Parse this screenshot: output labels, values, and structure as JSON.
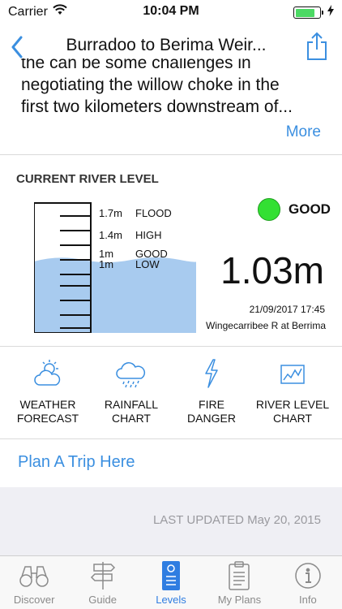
{
  "status_bar": {
    "carrier": "Carrier",
    "time": "10:04 PM",
    "battery_level": 0.8
  },
  "nav": {
    "title": "Burradoo to Berima Weir..."
  },
  "description": {
    "lines": [
      "the can be some challenges in",
      "negotiating the willow choke in the",
      "first two kilometers downstream of..."
    ],
    "more_label": "More"
  },
  "river_level": {
    "heading": "CURRENT RIVER LEVEL",
    "markers": [
      {
        "value": "1.7m",
        "label": "FLOOD"
      },
      {
        "value": "1.4m",
        "label": "HIGH"
      },
      {
        "value": "1m",
        "label": "GOOD"
      },
      {
        "value": "1m",
        "label": "LOW"
      }
    ],
    "status": "GOOD",
    "status_color": "#33e033",
    "reading": "1.03m",
    "reading_value_m": 1.03,
    "timestamp": "21/09/2017 17:45",
    "station": "Wingecarribee R at Berrima",
    "water_color": "#a8cbef"
  },
  "tools": [
    {
      "icon": "weather-forecast-icon",
      "line1": "WEATHER",
      "line2": "FORECAST"
    },
    {
      "icon": "rainfall-chart-icon",
      "line1": "RAINFALL",
      "line2": "CHART"
    },
    {
      "icon": "fire-danger-icon",
      "line1": "FIRE",
      "line2": "DANGER"
    },
    {
      "icon": "river-level-chart-icon",
      "line1": "RIVER LEVEL",
      "line2": "CHART"
    }
  ],
  "plan_trip_label": "Plan A Trip Here",
  "last_updated": "LAST UPDATED May 20, 2015",
  "tab_bar": {
    "active": "Levels",
    "tabs": [
      {
        "icon": "binoculars-icon",
        "label": "Discover"
      },
      {
        "icon": "signpost-icon",
        "label": "Guide"
      },
      {
        "icon": "level-gauge-icon",
        "label": "Levels"
      },
      {
        "icon": "clipboard-icon",
        "label": "My Plans"
      },
      {
        "icon": "info-icon",
        "label": "Info"
      }
    ]
  },
  "colors": {
    "accent": "#3b8fe0",
    "tab_active": "#2f7de1",
    "status_good": "#33e033"
  }
}
